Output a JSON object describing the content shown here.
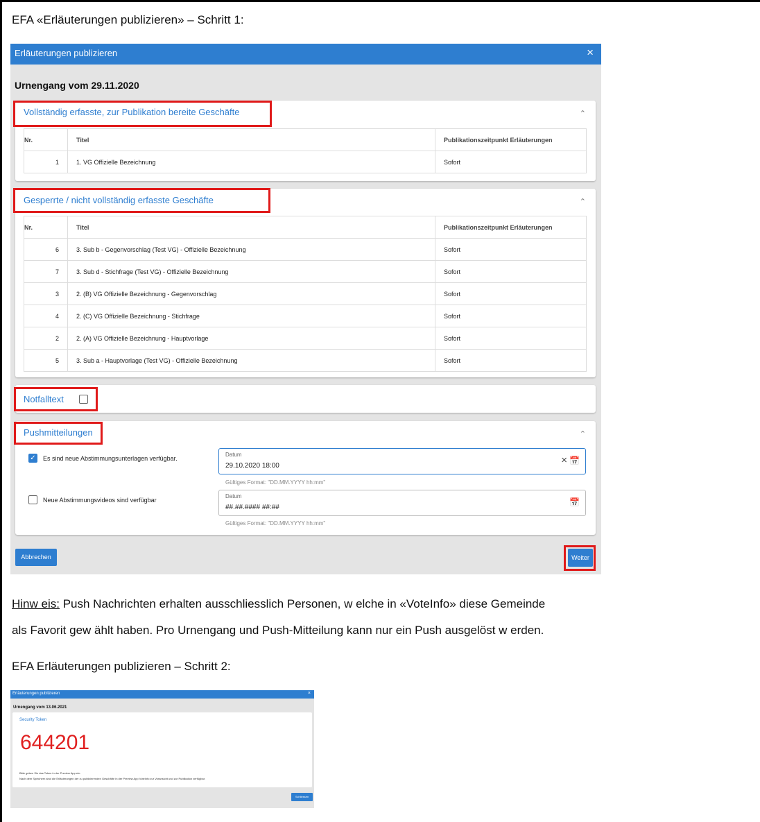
{
  "doc": {
    "step1_heading": "EFA «Erläuterungen publizieren» – Schritt 1:",
    "note_label": "Hinw eis:",
    "note_line1_rest": " Push Nachrichten erhalten ausschliesslich Personen, w elche in «VoteInfo» diese Gemeinde",
    "note_line2": "als Favorit gew ählt haben. Pro Urnengang und Push-Mitteilung kann nur ein Push ausgelöst w erden.",
    "step2_heading": "EFA Erläuterungen publizieren – Schritt 2:"
  },
  "dialog": {
    "title": "Erläuterungen publizieren",
    "close": "×",
    "urnengang": "Urnengang vom 29.11.2020",
    "chevron": "⌃",
    "columns": {
      "nr": "Nr.",
      "titel": "Titel",
      "pub": "Publikationszeitpunkt Erläuterungen"
    },
    "ready_title": "Vollständig erfasste, zur Publikation bereite Geschäfte",
    "ready_rows": [
      {
        "nr": "1",
        "titel": "1. VG Offizielle Bezeichnung",
        "pub": "Sofort"
      }
    ],
    "blocked_title": "Gesperrte / nicht vollständig erfasste Geschäfte",
    "blocked_rows": [
      {
        "nr": "6",
        "titel": "3. Sub b - Gegenvorschlag (Test VG) - Offizielle Bezeichnung",
        "pub": "Sofort"
      },
      {
        "nr": "7",
        "titel": "3. Sub d - Stichfrage (Test VG) - Offizielle Bezeichnung",
        "pub": "Sofort"
      },
      {
        "nr": "3",
        "titel": "2. (B) VG Offizielle Bezeichnung - Gegenvorschlag",
        "pub": "Sofort"
      },
      {
        "nr": "4",
        "titel": "2. (C) VG Offizielle Bezeichnung - Stichfrage",
        "pub": "Sofort"
      },
      {
        "nr": "2",
        "titel": "2. (A) VG Offizielle Bezeichnung - Hauptvorlage",
        "pub": "Sofort"
      },
      {
        "nr": "5",
        "titel": "3. Sub a - Hauptvorlage (Test VG) - Offizielle Bezeichnung",
        "pub": "Sofort"
      }
    ],
    "notfall_label": "Notfalltext",
    "push_title": "Pushmitteilungen",
    "push1_label": "Es sind neue Abstimmungsunterlagen verfügbar.",
    "push1_checked": true,
    "push1_field_label": "Datum",
    "push1_value": "29.10.2020 18:00",
    "push2_label": "Neue Abstimmungsvideos sind verfügbar",
    "push2_checked": false,
    "push2_field_label": "Datum",
    "push2_value": "##.##.#### ##:##",
    "format_hint": "Gültiges Format: \"DD.MM.YYYY hh:mm\"",
    "clear_icon": "×",
    "calendar_icon": "📅",
    "btn_cancel": "Abbrechen",
    "btn_next": "Weiter"
  },
  "step2": {
    "title": "Erläuterungen publizieren",
    "close": "×",
    "urnengang": "Urnengang vom 13.06.2021",
    "token_label": "Security Token",
    "token": "644201",
    "text1": "Bitte geben Sie das Token in der Preview App ein.",
    "text2": "Nach dem Speichern sind die Erläuterungen der zu publizierenden Geschäfte in der Preview App VoteInfo zur Voransicht und zur Publikation verfügbar.",
    "btn": "Schliessen"
  },
  "colors": {
    "accent": "#2e7ed0",
    "highlight": "#e01a1a",
    "token": "#e02020"
  }
}
